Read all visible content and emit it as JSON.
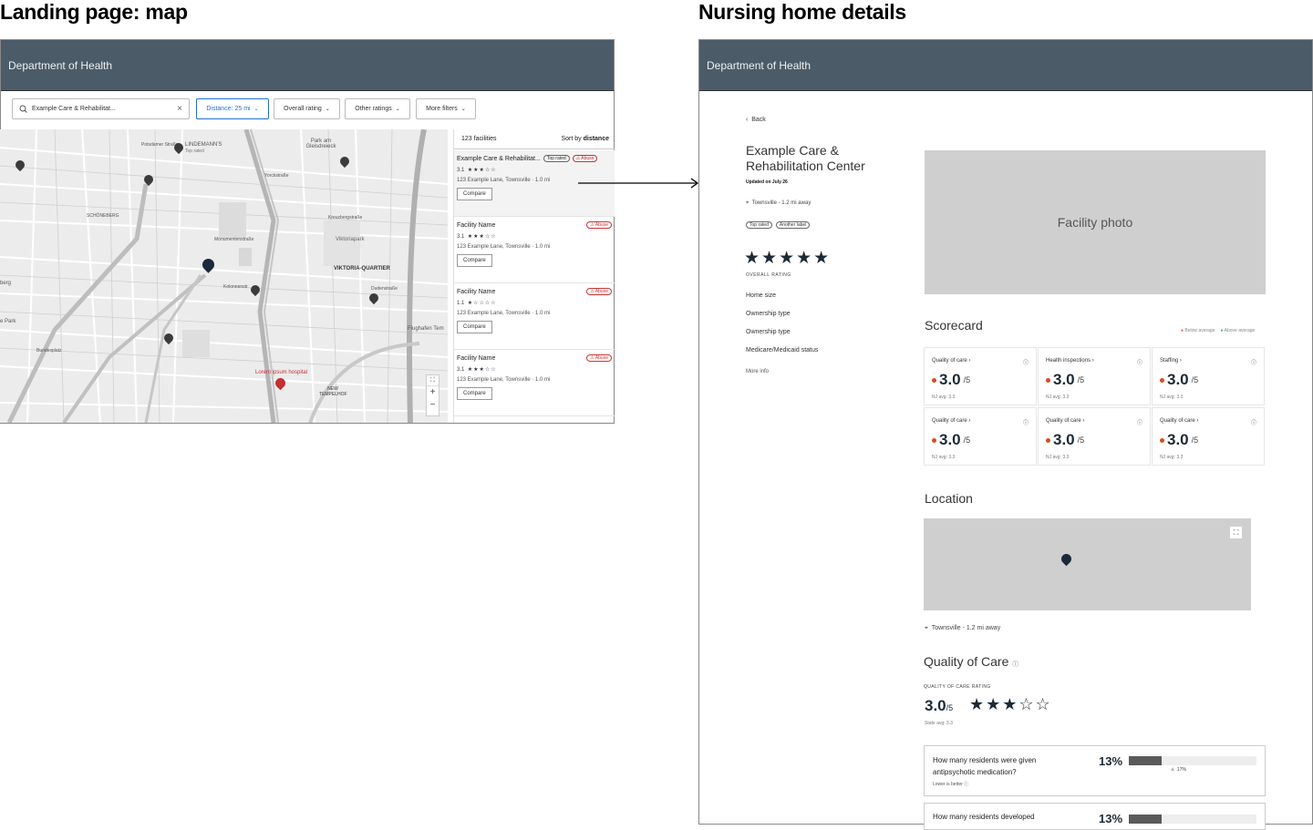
{
  "sections": {
    "left_title": "Landing page: map",
    "right_title": "Nursing home details"
  },
  "header": {
    "title": "Department of Health"
  },
  "search": {
    "value": "Example Care & Rehabilitat..."
  },
  "filters": [
    {
      "label": "Distance: 25 mi",
      "active": true
    },
    {
      "label": "Overall rating"
    },
    {
      "label": "Other ratings"
    },
    {
      "label": "More filters"
    }
  ],
  "map_labels": {
    "l1": "LINDEMANN'S",
    "l1b": "Top rated",
    "l2": "Park am Gleisdreieck",
    "l3": "SCHÖNEBERG",
    "l4": "Viktoriapark",
    "l5": "VIKTORIA-QUARTIER",
    "l6": "Flughafen Tem",
    "l7": "Lorem ipsum hospital",
    "l8": "NEW TEMPELHOF",
    "l9": "Monumentenstraße",
    "l10": "Kolonnenstr.",
    "l11": "Dudenstraße",
    "l12": "Yorckstraße",
    "l13": "Kreuzbergstraße",
    "l14": "Potsdamer Straße",
    "l15": "berg",
    "l16": "e Park",
    "l17": "Bundesplatz"
  },
  "list": {
    "count": "123 facilities",
    "sort_prefix": "Sort by ",
    "sort_value": "distance",
    "items": [
      {
        "name": "Example Care & Rehabilitat...",
        "tag1": "Top rated",
        "tag2": "⚠ Abuse",
        "rating": "3.1",
        "stars": "★★★☆☆",
        "address": "123 Example Lane, Townsville  ·  1.0 mi",
        "button": "Compare"
      },
      {
        "name": "Facility Name",
        "tag2": "⚠ Abuse",
        "rating": "3.1",
        "stars": "★★★☆☆",
        "address": "123 Example Lane, Townsville  ·  1.0 mi",
        "button": "Compare"
      },
      {
        "name": "Facility Name",
        "tag2": "⚠ Abuse",
        "rating": "1.1",
        "stars": "★☆☆☆☆",
        "address": "123 Example Lane, Townsville  ·  1.0 mi",
        "button": "Compare"
      },
      {
        "name": "Facility Name",
        "tag2": "⚠ Abuse",
        "rating": "3.1",
        "stars": "★★★☆☆",
        "address": "123 Example Lane, Townsville  ·  1.0 mi",
        "button": "Compare"
      }
    ]
  },
  "detail": {
    "back": "Back",
    "name_line1": "Example Care &",
    "name_line2": "Rehabilitation Center",
    "updated": "Updated on July 26",
    "location": "Townsville - 1.2 mi away",
    "tags": [
      "Top rated",
      "Another label"
    ],
    "stars": "★★★★★",
    "overall_label": "OVERALL RATING",
    "facts": [
      "Home size",
      "Ownership type",
      "Ownership type",
      "Medicare/Medicaid status"
    ],
    "more": "More info",
    "photo": "Facility photo",
    "scorecard": {
      "title": "Scorecard",
      "legend_below": "Below average",
      "legend_above": "Above average",
      "cards": [
        {
          "label": "Quality of care ›",
          "value": "3.0",
          "denom": "/5",
          "avg": "NJ avg: 3.3"
        },
        {
          "label": "Health inspections ›",
          "value": "3.0",
          "denom": "/5",
          "avg": "NJ avg: 3.3"
        },
        {
          "label": "Staffing ›",
          "value": "3.0",
          "denom": "/5",
          "avg": "NJ avg: 3.3"
        },
        {
          "label": "Quality of care ›",
          "value": "3.0",
          "denom": "/5",
          "avg": "NJ avg: 3.3"
        },
        {
          "label": "Quality of care ›",
          "value": "3.0",
          "denom": "/5",
          "avg": "NJ avg: 3.3"
        },
        {
          "label": "Quality of care ›",
          "value": "3.0",
          "denom": "/5",
          "avg": "NJ avg: 3.3"
        }
      ]
    },
    "location_title": "Location",
    "location_text": "Townsville - 1.2 mi away",
    "qoc": {
      "title": "Quality of Care",
      "label": "QUALITY OF CARE RATING",
      "value": "3.0",
      "denom": "/5",
      "stars": "★★★☆☆",
      "avg": "State avg: 3.3",
      "q1_line1": "How many residents were given",
      "q1_line2": "antipsychotic medication?",
      "q1_note": "Lower is better",
      "q1_pct": "13%",
      "q1_pct_fill": 0.13,
      "q1_avg": "17%",
      "q1_avg_fill": 0.17,
      "q2_line1": "How many residents developed",
      "q2_pct": "13%"
    }
  },
  "colors": {
    "header": "#4b5b68",
    "accent": "#1f6fd1",
    "below": "#e2553b",
    "above": "#24b8a6"
  }
}
